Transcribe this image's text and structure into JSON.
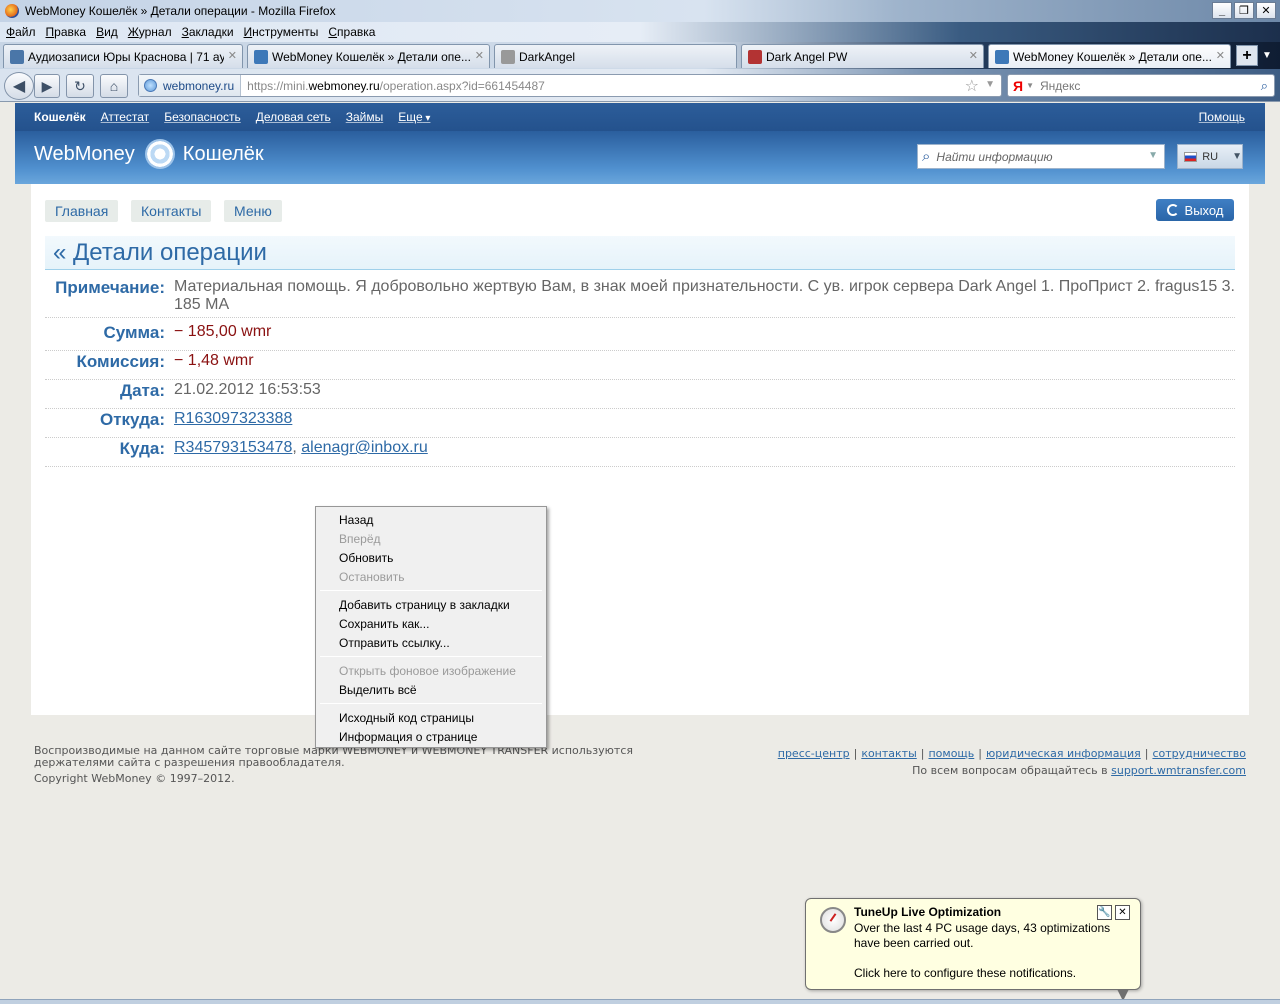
{
  "window": {
    "title": "WebMoney Кошелёк » Детали операции - Mozilla Firefox",
    "buttons": [
      "_",
      "❐",
      "✕"
    ]
  },
  "menubar": [
    "Файл",
    "Правка",
    "Вид",
    "Журнал",
    "Закладки",
    "Инструменты",
    "Справка"
  ],
  "tabs": [
    {
      "label": "Аудиозаписи Юры Краснова | 71 ау...",
      "fav": "vk-icon",
      "color": "#4a76a8"
    },
    {
      "label": "WebMoney Кошелёк » Детали опе...",
      "fav": "webmoney-icon",
      "color": "#3d78b8"
    },
    {
      "label": "DarkAngel",
      "fav": "page-icon",
      "color": "#999999"
    },
    {
      "label": "Dark Angel PW",
      "fav": "game-icon",
      "color": "#b33333"
    },
    {
      "label": "WebMoney Кошелёк » Детали опе...",
      "fav": "webmoney-icon",
      "color": "#3d78b8"
    }
  ],
  "newtab": "+",
  "address": {
    "host": "webmoney.ru",
    "url_pre": "https://mini.",
    "url_host": "webmoney.ru",
    "url_post": "/operation.aspx?id=661454487"
  },
  "search": {
    "engine": "Я",
    "placeholder": "Яндекс"
  },
  "wm": {
    "nav": [
      "Кошелёк",
      "Аттестат",
      "Безопасность",
      "Деловая сеть",
      "Займы",
      "Еще"
    ],
    "help": "Помощь",
    "logo_a": "WebMoney",
    "logo_b": "Кошелёк",
    "search_placeholder": "Найти информацию",
    "lang": "RU",
    "pills": [
      "Главная",
      "Контакты",
      "Меню"
    ],
    "logout": "Выход",
    "title": "« Детали операции",
    "details": {
      "note_label": "Примечание:",
      "note": "Материальная помощь. Я добровольно жертвую Вам, в знак моей признательности. С ув. игрок сервера Dark Angel 1. ПроПрист 2. fragus15 3. 185 МА",
      "sum_label": "Сумма:",
      "sum": "− 185,00 wmr",
      "fee_label": "Комиссия:",
      "fee": "− 1,48 wmr",
      "date_label": "Дата:",
      "date": "21.02.2012 16:53:53",
      "from_label": "Откуда:",
      "from": "R163097323388",
      "to_label": "Куда:",
      "to": "R345793153478",
      "to_sep": ", ",
      "to_email": "alenagr@inbox.ru"
    },
    "footer": {
      "l1": "Воспроизводимые на данном сайте торговые марки WEBMONEY и WEBMONEY TRANSFER используются",
      "l2": "держателями сайта с разрешения правообладателя.",
      "copy": "Copyright WebMoney © 1997–2012.",
      "links": [
        "пресс-центр",
        "контакты",
        "помощь",
        "юридическая информация",
        "сотрудничество"
      ],
      "contact_pre": "По всем вопросам обращайтесь в",
      "contact_link": "support.wmtransfer.com"
    }
  },
  "context_menu": [
    {
      "label": "Назад",
      "enabled": true
    },
    {
      "label": "Вперёд",
      "enabled": false
    },
    {
      "label": "Обновить",
      "enabled": true
    },
    {
      "label": "Остановить",
      "enabled": false
    },
    {
      "sep": true
    },
    {
      "label": "Добавить страницу в закладки",
      "enabled": true
    },
    {
      "label": "Сохранить как...",
      "enabled": true
    },
    {
      "label": "Отправить ссылку...",
      "enabled": true
    },
    {
      "sep": true
    },
    {
      "label": "Открыть фоновое изображение",
      "enabled": false
    },
    {
      "label": "Выделить всё",
      "enabled": true
    },
    {
      "sep": true
    },
    {
      "label": "Исходный код страницы",
      "enabled": true
    },
    {
      "label": "Информация о странице",
      "enabled": true
    }
  ],
  "notification": {
    "title": "TuneUp Live Optimization",
    "body": "Over the last 4 PC usage days, 43 optimizations have been carried out.",
    "link": "Click here to configure these notifications."
  }
}
